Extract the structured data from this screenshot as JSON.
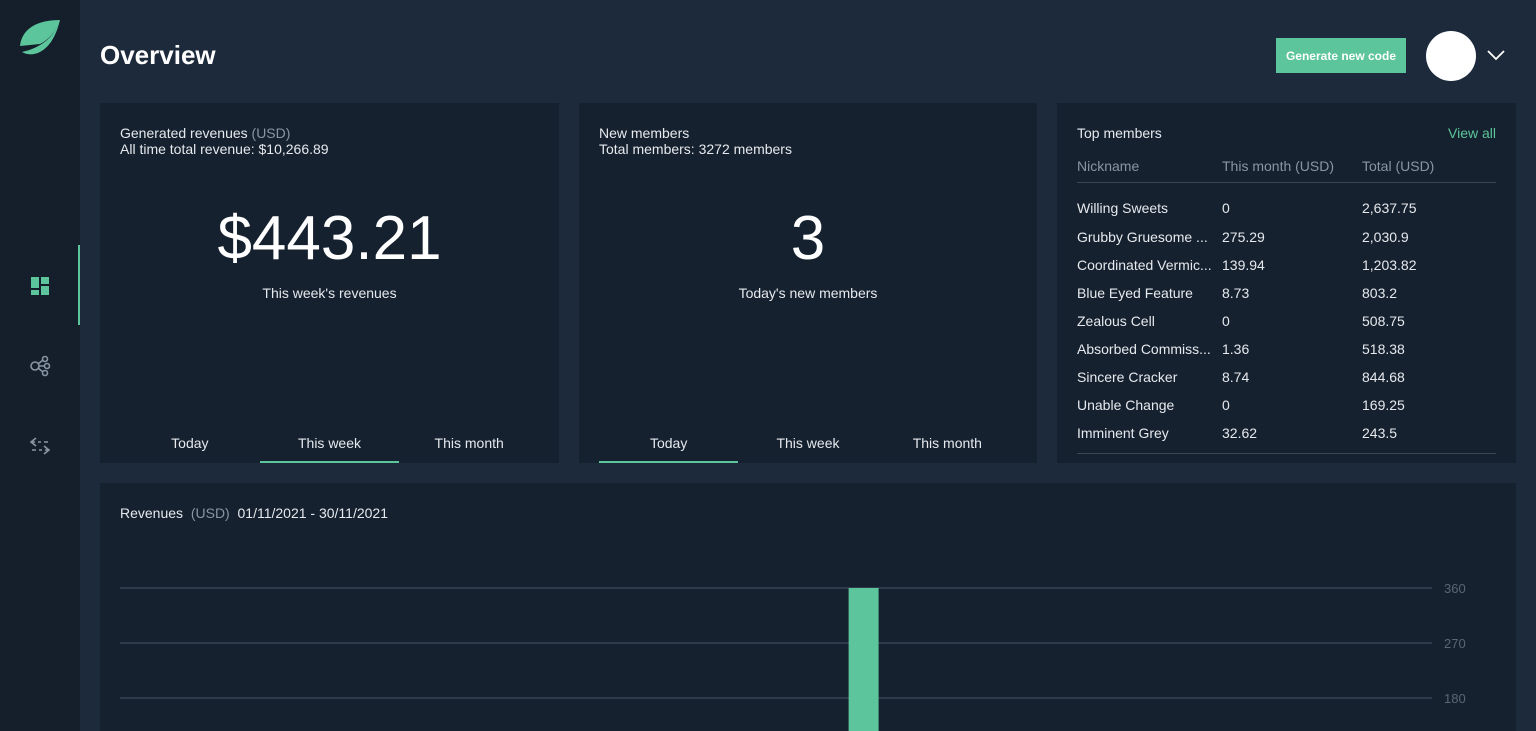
{
  "colors": {
    "accent": "#5cc59b",
    "background": "#1c2a3b",
    "card": "#15212e",
    "sidebar": "#141f2b"
  },
  "sidebar": {
    "logo": "leaf-logo",
    "items": [
      {
        "icon": "dashboard-icon",
        "active": true
      },
      {
        "icon": "share-icon",
        "active": false
      },
      {
        "icon": "transfer-icon",
        "active": false
      }
    ]
  },
  "header": {
    "title": "Overview",
    "generate_label": "Generate new code"
  },
  "revenue": {
    "title": "Generated revenues",
    "unit": "(USD)",
    "total": "All time total revenue: $10,266.89",
    "value": "$443.21",
    "caption": "This week's revenues",
    "tabs": [
      "Today",
      "This week",
      "This month"
    ],
    "active_tab": 1
  },
  "members": {
    "title": "New members",
    "total": "Total members: 3272 members",
    "value": "3",
    "caption": "Today's new members",
    "tabs": [
      "Today",
      "This week",
      "This month"
    ],
    "active_tab": 0
  },
  "top": {
    "title": "Top members",
    "view_all": "View all",
    "columns": [
      "Nickname",
      "This month (USD)",
      "Total (USD)"
    ],
    "rows": [
      [
        "Willing Sweets",
        "0",
        "2,637.75"
      ],
      [
        "Grubby Gruesome ...",
        "275.29",
        "2,030.9"
      ],
      [
        "Coordinated Vermic...",
        "139.94",
        "1,203.82"
      ],
      [
        "Blue Eyed Feature",
        "8.73",
        "803.2"
      ],
      [
        "Zealous Cell",
        "0",
        "508.75"
      ],
      [
        "Absorbed Commiss...",
        "1.36",
        "518.38"
      ],
      [
        "Sincere Cracker",
        "8.74",
        "844.68"
      ],
      [
        "Unable Change",
        "0",
        "169.25"
      ],
      [
        "Imminent Grey",
        "32.62",
        "243.5"
      ]
    ]
  },
  "chart_data": {
    "type": "bar",
    "title": "Revenues",
    "unit": "(USD)",
    "range": "01/11/2021 - 30/11/2021",
    "yticks": [
      "360",
      "270",
      "180"
    ],
    "ylim": [
      0,
      360
    ],
    "grid": true,
    "values": [
      0,
      0,
      0,
      0,
      0,
      0,
      0,
      0,
      0,
      0,
      0,
      0,
      0,
      0,
      0,
      0,
      360,
      0,
      0,
      0,
      0,
      0,
      0,
      0,
      0,
      0,
      0,
      0,
      0,
      0
    ]
  }
}
